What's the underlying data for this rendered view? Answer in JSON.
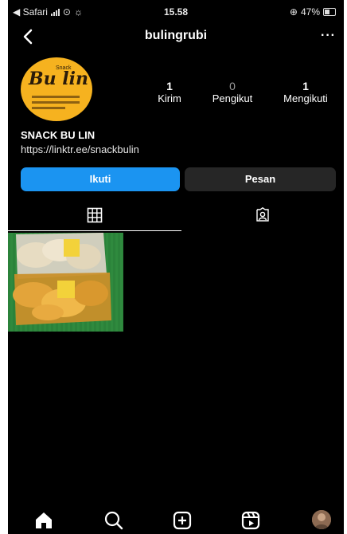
{
  "status_bar": {
    "carrier": "◀ Safari",
    "time": "15.58",
    "battery": "47%"
  },
  "header": {
    "username": "bulingrubi",
    "more": "···"
  },
  "profile": {
    "avatar_brand": "Bu lin",
    "avatar_small": "Snack",
    "display_name": "SNACK BU LIN",
    "link": "https://linktr.ee/snackbulin",
    "stats": [
      {
        "value": "1",
        "label": "Kirim"
      },
      {
        "value": "0",
        "label": "Pengikut"
      },
      {
        "value": "1",
        "label": "Mengikuti"
      }
    ]
  },
  "buttons": {
    "follow": "Ikuti",
    "message": "Pesan"
  },
  "tabs": {
    "active": "grid",
    "items": [
      "grid",
      "tagged"
    ]
  },
  "colors": {
    "background": "#000000",
    "follow_button": "#1b94f1",
    "message_button": "#262626",
    "muted_text": "#9a9a9a"
  },
  "icons": {
    "back": "chevron-left-icon",
    "grid": "grid-icon",
    "tagged": "tagged-person-icon",
    "home": "home-icon",
    "search": "search-icon",
    "add": "plus-square-icon",
    "reels": "reels-icon"
  }
}
